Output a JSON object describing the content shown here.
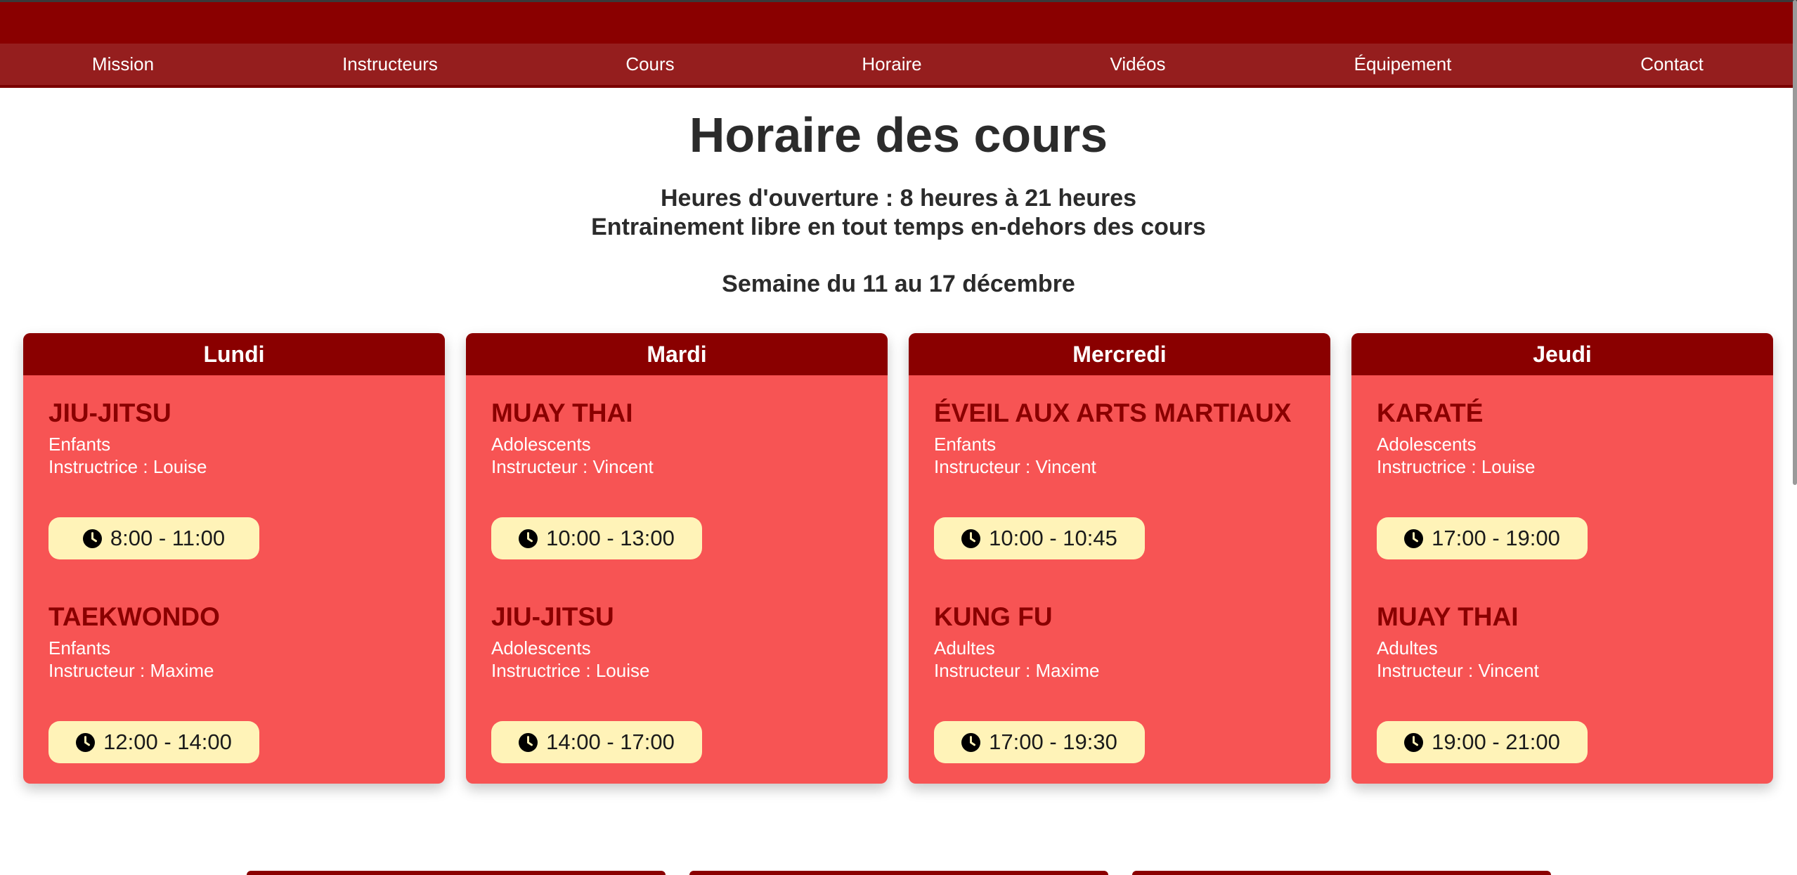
{
  "nav": {
    "items": [
      "Mission",
      "Instructeurs",
      "Cours",
      "Horaire",
      "Vidéos",
      "Équipement",
      "Contact"
    ]
  },
  "header": {
    "title": "Horaire des cours",
    "hours": "Heures d'ouverture : 8 heures à 21 heures",
    "open_training": "Entrainement libre en tout temps en-dehors des cours",
    "week": "Semaine du 11 au 17 décembre"
  },
  "schedule": {
    "days": [
      {
        "day": "Lundi",
        "courses": [
          {
            "name": "JIU-JITSU",
            "level": "Enfants",
            "instructor": "Instructrice : Louise",
            "time": "8:00 - 11:00"
          },
          {
            "name": "TAEKWONDO",
            "level": "Enfants",
            "instructor": "Instructeur : Maxime",
            "time": "12:00 - 14:00"
          }
        ]
      },
      {
        "day": "Mardi",
        "courses": [
          {
            "name": "MUAY THAI",
            "level": "Adolescents",
            "instructor": "Instructeur : Vincent",
            "time": "10:00 - 13:00"
          },
          {
            "name": "JIU-JITSU",
            "level": "Adolescents",
            "instructor": "Instructrice : Louise",
            "time": "14:00 - 17:00"
          }
        ]
      },
      {
        "day": "Mercredi",
        "courses": [
          {
            "name": "ÉVEIL AUX ARTS MARTIAUX",
            "level": "Enfants",
            "instructor": "Instructeur : Vincent",
            "time": "10:00 - 10:45"
          },
          {
            "name": "KUNG FU",
            "level": "Adultes",
            "instructor": "Instructeur : Maxime",
            "time": "17:00 - 19:30"
          }
        ]
      },
      {
        "day": "Jeudi",
        "courses": [
          {
            "name": "KARATÉ",
            "level": "Adolescents",
            "instructor": "Instructrice : Louise",
            "time": "17:00 - 19:00"
          },
          {
            "name": "MUAY THAI",
            "level": "Adultes",
            "instructor": "Instructeur : Vincent",
            "time": "19:00 - 21:00"
          }
        ]
      }
    ]
  },
  "colors": {
    "brand_dark": "#8a0000",
    "nav_bg": "#951e1e",
    "card_bg": "#f75454",
    "time_pill_bg": "#fff3b8"
  },
  "icons": {
    "time": "clock-icon"
  }
}
